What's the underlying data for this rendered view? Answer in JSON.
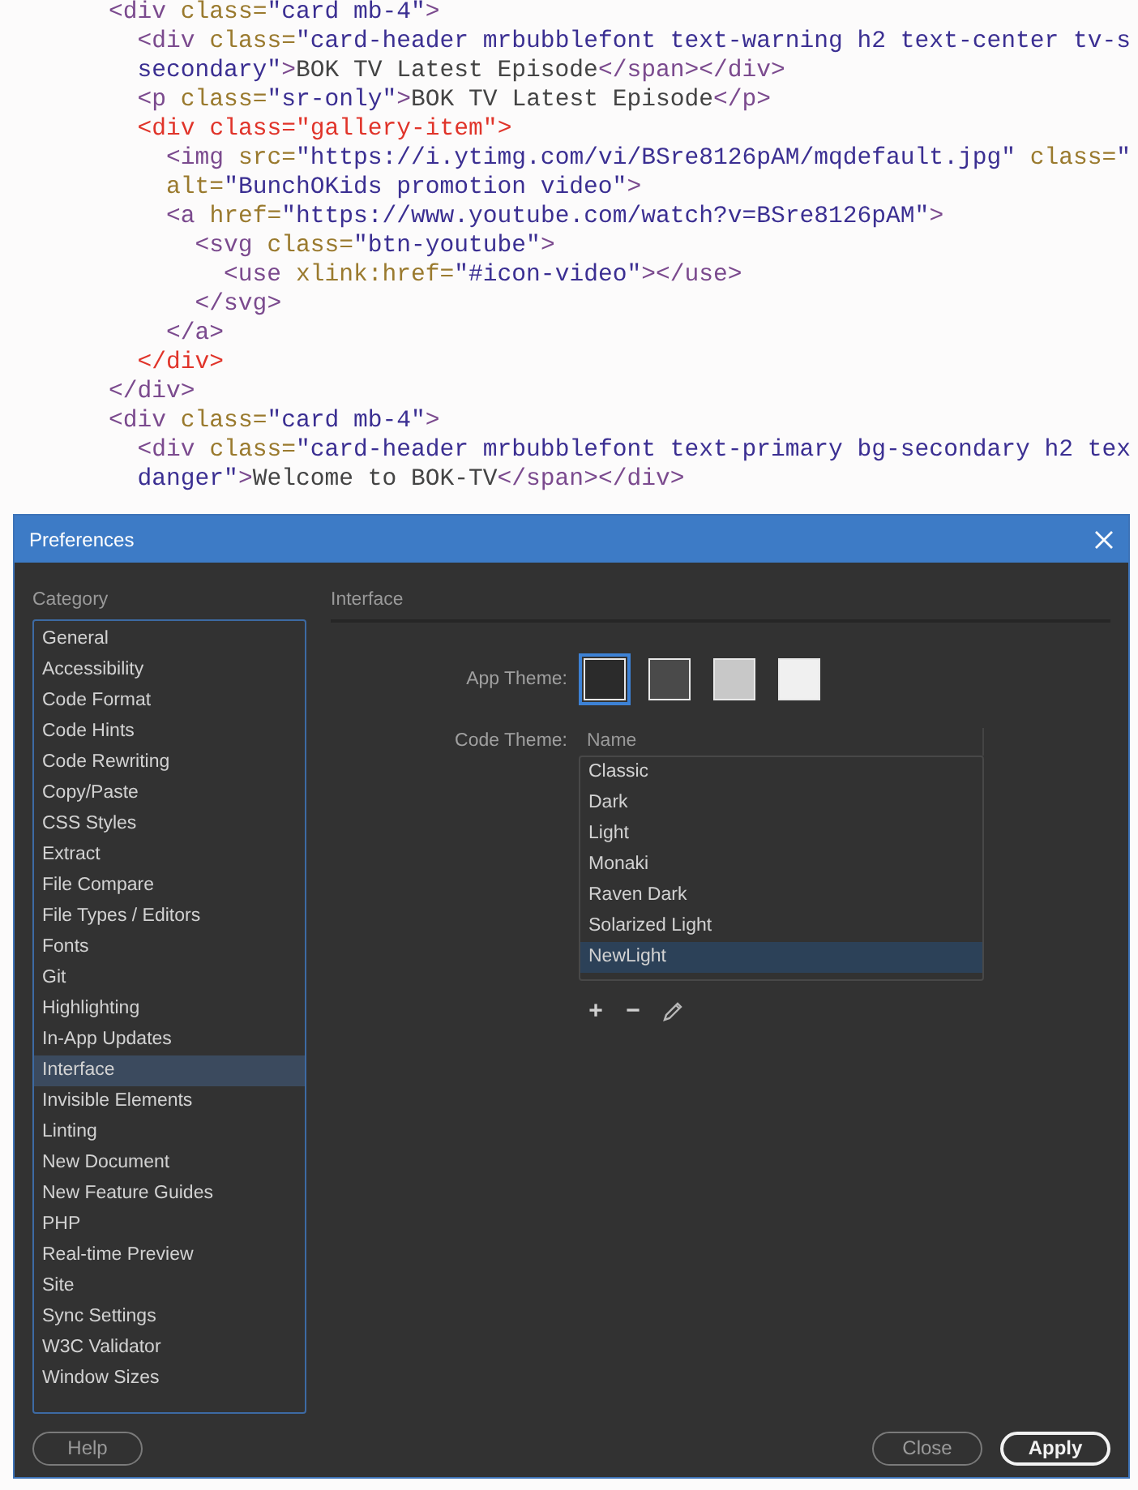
{
  "editor": {
    "lines": [
      {
        "text": "<div class=\"card mb-4\">",
        "highlighted": false
      },
      {
        "text": "  <div class=\"card-header mrbubblefont text-warning h2 text-center tv-s",
        "highlighted": false
      },
      {
        "text": "  secondary\">BOK TV Latest Episode</span></div>",
        "highlighted": false
      },
      {
        "text": "  <p class=\"sr-only\">BOK TV Latest Episode</p>",
        "highlighted": false
      },
      {
        "text": "  <div class=\"gallery-item\">",
        "highlighted": true
      },
      {
        "text": "    <img src=\"https://i.ytimg.com/vi/BSre8126pAM/mqdefault.jpg\" class=\"",
        "highlighted": false
      },
      {
        "text": "    alt=\"BunchOKids promotion video\">",
        "highlighted": false
      },
      {
        "text": "    <a href=\"https://www.youtube.com/watch?v=BSre8126pAM\">",
        "highlighted": false
      },
      {
        "text": "      <svg class=\"btn-youtube\">",
        "highlighted": false
      },
      {
        "text": "        <use xlink:href=\"#icon-video\"></use>",
        "highlighted": false
      },
      {
        "text": "      </svg>",
        "highlighted": false
      },
      {
        "text": "    </a>",
        "highlighted": false
      },
      {
        "text": "  </div>",
        "highlighted": true
      },
      {
        "text": "</div>",
        "highlighted": false
      },
      {
        "text": "<div class=\"card mb-4\">",
        "highlighted": false
      },
      {
        "text": "  <div class=\"card-header mrbubblefont text-primary bg-secondary h2 tex",
        "highlighted": false
      },
      {
        "text": "  danger\">Welcome to BOK-TV</span></div>",
        "highlighted": false
      }
    ]
  },
  "dialog": {
    "title": "Preferences",
    "category_label": "Category",
    "categories": [
      {
        "label": "General",
        "selected": false
      },
      {
        "label": "Accessibility",
        "selected": false
      },
      {
        "label": "Code Format",
        "selected": false
      },
      {
        "label": "Code Hints",
        "selected": false
      },
      {
        "label": "Code Rewriting",
        "selected": false
      },
      {
        "label": "Copy/Paste",
        "selected": false
      },
      {
        "label": "CSS Styles",
        "selected": false
      },
      {
        "label": "Extract",
        "selected": false
      },
      {
        "label": "File Compare",
        "selected": false
      },
      {
        "label": "File Types / Editors",
        "selected": false
      },
      {
        "label": "Fonts",
        "selected": false
      },
      {
        "label": "Git",
        "selected": false
      },
      {
        "label": "Highlighting",
        "selected": false
      },
      {
        "label": "In-App Updates",
        "selected": false
      },
      {
        "label": "Interface",
        "selected": true
      },
      {
        "label": "Invisible Elements",
        "selected": false
      },
      {
        "label": "Linting",
        "selected": false
      },
      {
        "label": "New Document",
        "selected": false
      },
      {
        "label": "New Feature Guides",
        "selected": false
      },
      {
        "label": "PHP",
        "selected": false
      },
      {
        "label": "Real-time Preview",
        "selected": false
      },
      {
        "label": "Site",
        "selected": false
      },
      {
        "label": "Sync Settings",
        "selected": false
      },
      {
        "label": "W3C Validator",
        "selected": false
      },
      {
        "label": "Window Sizes",
        "selected": false
      }
    ],
    "panel_title": "Interface",
    "app_theme": {
      "label": "App Theme:",
      "swatches": [
        {
          "color": "#2b2b2b",
          "selected": true
        },
        {
          "color": "#4a4a4a",
          "selected": false
        },
        {
          "color": "#c8c8c8",
          "selected": false
        },
        {
          "color": "#f0f0f0",
          "selected": false
        }
      ]
    },
    "code_theme": {
      "label": "Code Theme:",
      "column": "Name",
      "themes": [
        {
          "name": "Classic",
          "selected": false
        },
        {
          "name": "Dark",
          "selected": false
        },
        {
          "name": "Light",
          "selected": false
        },
        {
          "name": "Monaki",
          "selected": false
        },
        {
          "name": "Raven Dark",
          "selected": false
        },
        {
          "name": "Solarized Light",
          "selected": false
        },
        {
          "name": "NewLight",
          "selected": true
        }
      ],
      "tools": [
        "+",
        "−"
      ]
    },
    "left_buttons": [
      {
        "label": "Help",
        "primary": false
      }
    ],
    "right_buttons": [
      {
        "label": "Close",
        "primary": false
      },
      {
        "label": "Apply",
        "primary": true
      }
    ]
  }
}
